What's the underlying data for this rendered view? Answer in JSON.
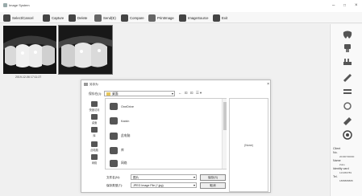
{
  "window": {
    "title": "Image System",
    "controls": {
      "minimize": "–",
      "maximize": "□",
      "close": "×"
    }
  },
  "toolbar": {
    "items": [
      {
        "label": "Select/Cancel",
        "icon": "select-icon"
      },
      {
        "label": "Capture",
        "icon": "camera-icon"
      },
      {
        "label": "Delete",
        "icon": "delete-icon"
      },
      {
        "label": "Send(E)",
        "icon": "send-icon"
      },
      {
        "label": "Compare",
        "icon": "compare-icon"
      },
      {
        "label": "PrintImage",
        "icon": "print-icon"
      },
      {
        "label": "ImageSource",
        "icon": "image-source-icon"
      },
      {
        "label": "Exit",
        "icon": "exit-icon"
      }
    ]
  },
  "gallery": {
    "timestamp": "2019-12-06 17:11:27"
  },
  "sidebar": {
    "icons": [
      "tooth-icon",
      "tooth-tools-icon",
      "toothbrush-icon",
      "tools-icon",
      "equalize-icon",
      "rotate-icon",
      "brush-icon",
      "record-icon"
    ],
    "client": {
      "heading": "Client",
      "no_label": "No.",
      "no_value": "20190730000",
      "name_label": "Name",
      "name_value": "Zoho",
      "identity_label": "Identity card",
      "identity_value": "123456789",
      "tel_label": "Tel.",
      "tel_value": "1888888888"
    }
  },
  "dialog": {
    "title": "另存为",
    "close": "×",
    "look_in_label": "保存在(I):",
    "look_in_value": "桌面",
    "nav_buttons": "← ⊡ ⊡ ☰▾",
    "places": [
      {
        "label": "快速访问",
        "icon": "quick-access-icon"
      },
      {
        "label": "桌面",
        "icon": "desktop-icon"
      },
      {
        "label": "库",
        "icon": "library-icon"
      },
      {
        "label": "此电脑",
        "icon": "this-pc-icon"
      },
      {
        "label": "网络",
        "icon": "network-icon"
      }
    ],
    "files": [
      {
        "name": "OneDrive",
        "icon": "onedrive-icon"
      },
      {
        "name": "Kaixin",
        "icon": "user-folder-icon"
      },
      {
        "name": "此电脑",
        "icon": "computer-icon"
      },
      {
        "name": "库",
        "icon": "library-folder-icon"
      },
      {
        "name": "网络",
        "icon": "network-folder-icon"
      }
    ],
    "preview_text": "(None)",
    "filename_label": "文件名(N):",
    "filename_value": "图片",
    "filetype_label": "保存类型(T):",
    "filetype_value": "JPEG Image File (*.jpg)",
    "save_button": "保存(S)",
    "cancel_button": "取消"
  }
}
